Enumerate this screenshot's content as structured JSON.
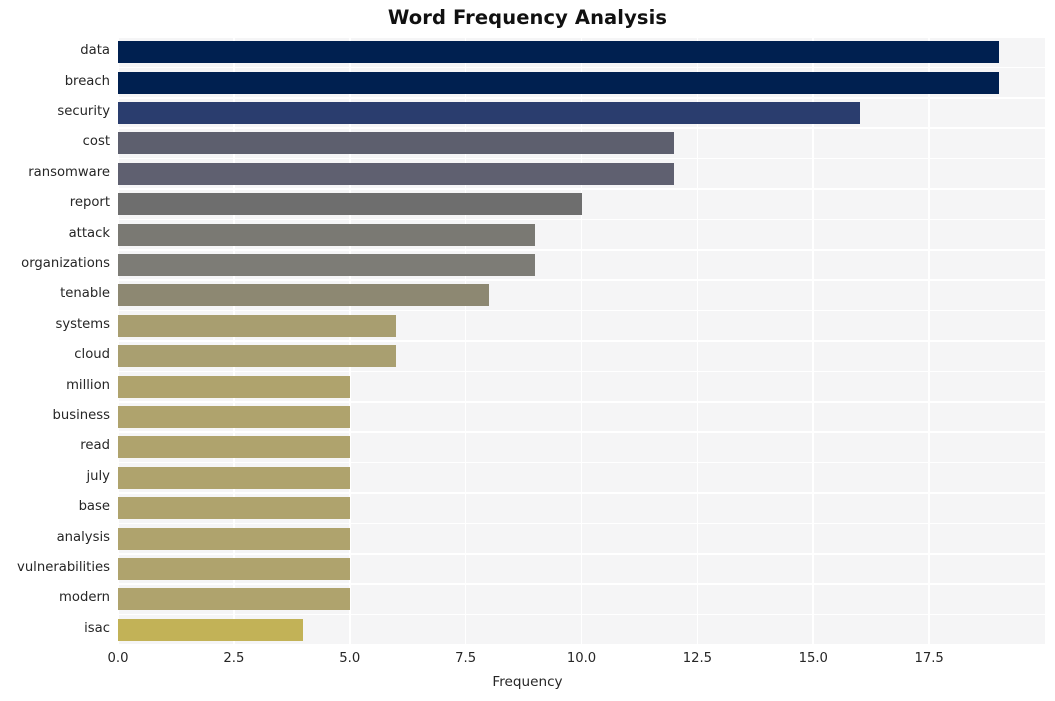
{
  "chart_data": {
    "type": "bar",
    "orientation": "horizontal",
    "title": "Word Frequency Analysis",
    "xlabel": "Frequency",
    "ylabel": "",
    "categories": [
      "data",
      "breach",
      "security",
      "cost",
      "ransomware",
      "report",
      "attack",
      "organizations",
      "tenable",
      "systems",
      "cloud",
      "million",
      "business",
      "read",
      "july",
      "base",
      "analysis",
      "vulnerabilities",
      "modern",
      "isac"
    ],
    "values": [
      19,
      19,
      16,
      12,
      12,
      10,
      9,
      9,
      8,
      6,
      6,
      5,
      5,
      5,
      5,
      5,
      5,
      5,
      5,
      4
    ],
    "bar_colors": [
      "#002050",
      "#002050",
      "#2a3d6e",
      "#5d5f6e",
      "#5f6070",
      "#6e6e6e",
      "#7a7973",
      "#7d7c76",
      "#8d8872",
      "#a89e70",
      "#a99f70",
      "#af a36d",
      "#afa36d",
      "#afa36d",
      "#afa36d",
      "#afa36d",
      "#afa36d",
      "#afa36d",
      "#afa36d",
      "#c2b257"
    ],
    "xticks": [
      "0.0",
      "2.5",
      "5.0",
      "7.5",
      "10.0",
      "12.5",
      "15.0",
      "17.5"
    ],
    "xtick_values": [
      0,
      2.5,
      5,
      7.5,
      10,
      12.5,
      15,
      17.5
    ],
    "xlim": [
      0,
      20
    ],
    "grid": true,
    "legend": false,
    "plot_background": "#f5f5f6",
    "gridline_color": "#ffffff",
    "figure_background": "#ffffff",
    "title_color": "#111111",
    "tick_color": "#262626"
  }
}
